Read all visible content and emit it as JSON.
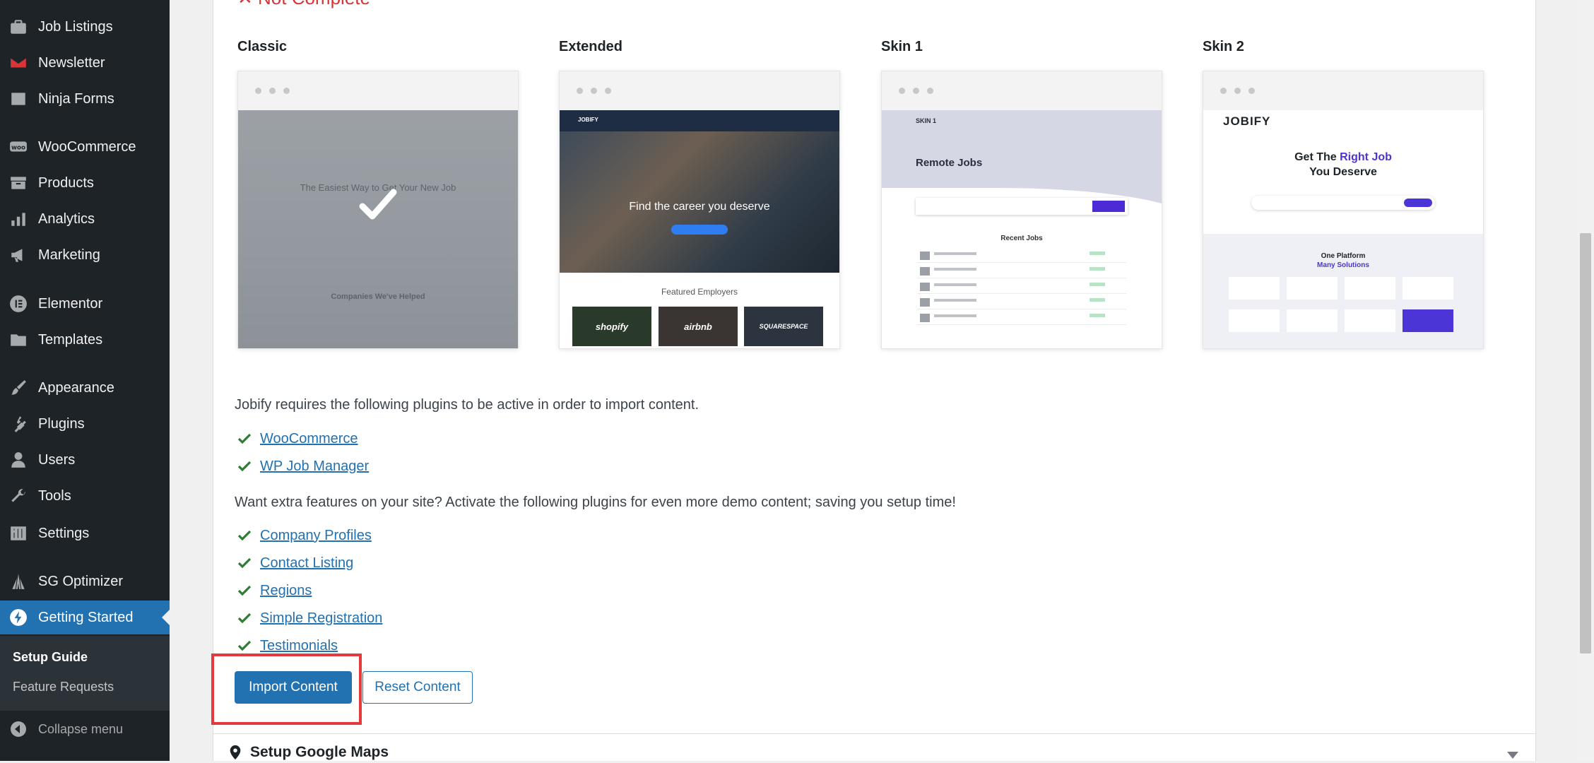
{
  "sidebar": {
    "items": [
      {
        "label": "Job Listings",
        "icon": "briefcase-icon"
      },
      {
        "label": "Newsletter",
        "icon": "mail-icon"
      },
      {
        "label": "Ninja Forms",
        "icon": "form-icon"
      },
      {
        "label": "WooCommerce",
        "icon": "woocommerce-icon"
      },
      {
        "label": "Products",
        "icon": "archive-icon"
      },
      {
        "label": "Analytics",
        "icon": "bar-chart-icon"
      },
      {
        "label": "Marketing",
        "icon": "megaphone-icon"
      },
      {
        "label": "Elementor",
        "icon": "elementor-icon"
      },
      {
        "label": "Templates",
        "icon": "folder-icon"
      },
      {
        "label": "Appearance",
        "icon": "paintbrush-icon"
      },
      {
        "label": "Plugins",
        "icon": "plug-icon"
      },
      {
        "label": "Users",
        "icon": "user-icon"
      },
      {
        "label": "Tools",
        "icon": "wrench-icon"
      },
      {
        "label": "Settings",
        "icon": "sliders-icon"
      },
      {
        "label": "SG Optimizer",
        "icon": "sg-optimizer-icon"
      },
      {
        "label": "Getting Started",
        "icon": "lightning-icon"
      }
    ],
    "submenu": [
      "Setup Guide",
      "Feature Requests"
    ],
    "collapse_label": "Collapse menu"
  },
  "main": {
    "status_heading": "✕ Not Complete",
    "demos": [
      {
        "name": "Classic"
      },
      {
        "name": "Extended"
      },
      {
        "name": "Skin 1"
      },
      {
        "name": "Skin 2"
      }
    ],
    "previews": {
      "classic": {
        "headline": "The Easiest Way to Get Your New Job",
        "sub": "Companies We've Helped"
      },
      "extended": {
        "brand": "JOBIFY",
        "headline": "Find the career you deserve",
        "featured": "Featured Employers",
        "logos": [
          "shopify",
          "airbnb",
          "SQUARESPACE"
        ]
      },
      "skin1": {
        "brand": "SKIN 1",
        "headline": "Remote Jobs",
        "section": "Recent Jobs"
      },
      "skin2": {
        "brand": "JOBIFY",
        "headline_pre": "Get The ",
        "headline_accent": "Right Job",
        "headline_post": "You Deserve",
        "section": "One Platform",
        "section_accent": "Many Solutions"
      }
    },
    "required_text": "Jobify requires the following plugins to be active in order to import content.",
    "required_plugins": [
      "WooCommerce",
      "WP Job Manager"
    ],
    "extra_text": "Want extra features on your site? Activate the following plugins for even more demo content; saving you setup time!",
    "extra_plugins": [
      "Company Profiles",
      "Contact Listing",
      "Regions",
      "Simple Registration",
      "Testimonials"
    ],
    "import_label": "Import Content",
    "reset_label": "Reset Content",
    "next_section": "Setup Google Maps"
  },
  "colors": {
    "sidebar_bg": "#1d2327",
    "accent": "#2271b1",
    "check": "#2e7d32",
    "status_red": "#d63638",
    "highlight": "#e5393c"
  }
}
